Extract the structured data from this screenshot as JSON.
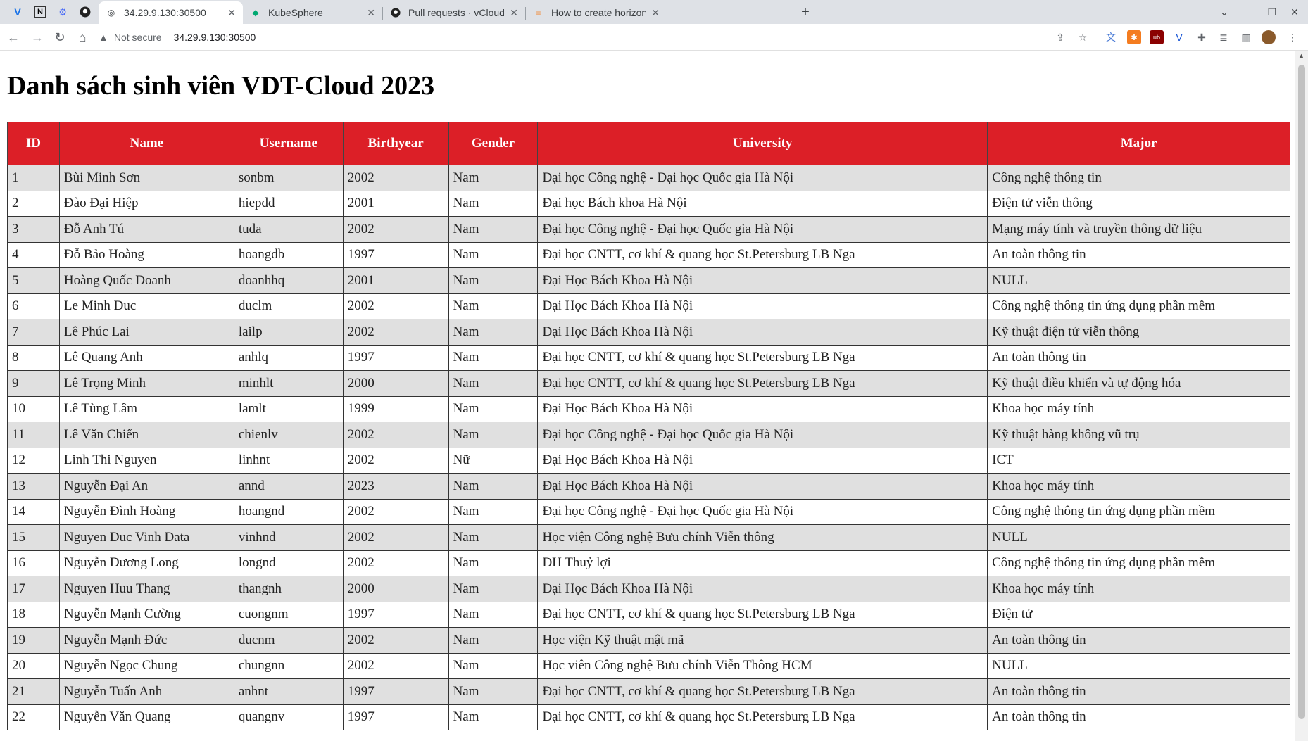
{
  "tabs": [
    {
      "title": "34.29.9.130:30500",
      "active": true
    },
    {
      "title": "KubeSphere",
      "active": false
    },
    {
      "title": "Pull requests · vCloud-DFI",
      "active": false
    },
    {
      "title": "How to create horizontal",
      "active": false
    }
  ],
  "address_bar": {
    "security_label": "Not secure",
    "url": "34.29.9.130:30500"
  },
  "page": {
    "title": "Danh sách sinh viên VDT-Cloud 2023",
    "columns": [
      "ID",
      "Name",
      "Username",
      "Birthyear",
      "Gender",
      "University",
      "Major"
    ],
    "rows": [
      [
        "1",
        "Bùi Minh Sơn",
        "sonbm",
        "2002",
        "Nam",
        "Đại học Công nghệ - Đại học Quốc gia Hà Nội",
        "Công nghệ thông tin"
      ],
      [
        "2",
        "Đào Đại Hiệp",
        "hiepdd",
        "2001",
        "Nam",
        "Đại học Bách khoa Hà Nội",
        "Điện tử viễn thông"
      ],
      [
        "3",
        "Đỗ Anh Tú",
        "tuda",
        "2002",
        "Nam",
        "Đại học Công nghệ - Đại học Quốc gia Hà Nội",
        "Mạng máy tính và truyền thông dữ liệu"
      ],
      [
        "4",
        "Đỗ Bảo Hoàng",
        "hoangdb",
        "1997",
        "Nam",
        "Đại học CNTT, cơ khí & quang học St.Petersburg LB Nga",
        "An toàn thông tin"
      ],
      [
        "5",
        "Hoàng Quốc Doanh",
        "doanhhq",
        "2001",
        "Nam",
        "Đại Học Bách Khoa Hà Nội",
        "NULL"
      ],
      [
        "6",
        "Le Minh Duc",
        "duclm",
        "2002",
        "Nam",
        "Đại Học Bách Khoa Hà Nội",
        "Công nghệ thông tin ứng dụng phần mềm"
      ],
      [
        "7",
        "Lê Phúc Lai",
        "lailp",
        "2002",
        "Nam",
        "Đại Học Bách Khoa Hà Nội",
        "Kỹ thuật điện tử viễn thông"
      ],
      [
        "8",
        "Lê Quang Anh",
        "anhlq",
        "1997",
        "Nam",
        "Đại học CNTT, cơ khí & quang học St.Petersburg LB Nga",
        "An toàn thông tin"
      ],
      [
        "9",
        "Lê Trọng Minh",
        "minhlt",
        "2000",
        "Nam",
        "Đại học CNTT, cơ khí & quang học St.Petersburg LB Nga",
        "Kỹ thuật điều khiển và tự động hóa"
      ],
      [
        "10",
        "Lê Tùng Lâm",
        "lamlt",
        "1999",
        "Nam",
        "Đại Học Bách Khoa Hà Nội",
        "Khoa học máy tính"
      ],
      [
        "11",
        "Lê Văn Chiến",
        "chienlv",
        "2002",
        "Nam",
        "Đại học Công nghệ - Đại học Quốc gia Hà Nội",
        "Kỹ thuật hàng không vũ trụ"
      ],
      [
        "12",
        "Linh Thi Nguyen",
        "linhnt",
        "2002",
        "Nữ",
        "Đại Học Bách Khoa Hà Nội",
        "ICT"
      ],
      [
        "13",
        "Nguyễn Đại An",
        "annd",
        "2023",
        "Nam",
        "Đại Học Bách Khoa Hà Nội",
        "Khoa học máy tính"
      ],
      [
        "14",
        "Nguyễn Đình Hoàng",
        "hoangnd",
        "2002",
        "Nam",
        "Đại học Công nghệ - Đại học Quốc gia Hà Nội",
        "Công nghệ thông tin ứng dụng phần mềm"
      ],
      [
        "15",
        "Nguyen Duc Vinh Data",
        "vinhnd",
        "2002",
        "Nam",
        "Học viện Công nghệ Bưu chính Viễn thông",
        "NULL"
      ],
      [
        "16",
        "Nguyễn Dương Long",
        "longnd",
        "2002",
        "Nam",
        "ĐH Thuỷ lợi",
        "Công nghệ thông tin ứng dụng phần mềm"
      ],
      [
        "17",
        "Nguyen Huu Thang",
        "thangnh",
        "2000",
        "Nam",
        "Đại Học Bách Khoa Hà Nội",
        "Khoa học máy tính"
      ],
      [
        "18",
        "Nguyễn Mạnh Cường",
        "cuongnm",
        "1997",
        "Nam",
        "Đại học CNTT, cơ khí & quang học St.Petersburg LB Nga",
        "Điện tử"
      ],
      [
        "19",
        "Nguyễn Mạnh Đức",
        "ducnm",
        "2002",
        "Nam",
        "Học viện Kỹ thuật mật mã",
        "An toàn thông tin"
      ],
      [
        "20",
        "Nguyễn Ngọc Chung",
        "chungnn",
        "2002",
        "Nam",
        "Học viên Công nghệ Bưu chính Viễn Thông HCM",
        "NULL"
      ],
      [
        "21",
        "Nguyễn Tuấn Anh",
        "anhnt",
        "1997",
        "Nam",
        "Đại học CNTT, cơ khí & quang học St.Petersburg LB Nga",
        "An toàn thông tin"
      ],
      [
        "22",
        "Nguyễn Văn Quang",
        "quangnv",
        "1997",
        "Nam",
        "Đại học CNTT, cơ khí & quang học St.Petersburg LB Nga",
        "An toàn thông tin"
      ]
    ]
  }
}
